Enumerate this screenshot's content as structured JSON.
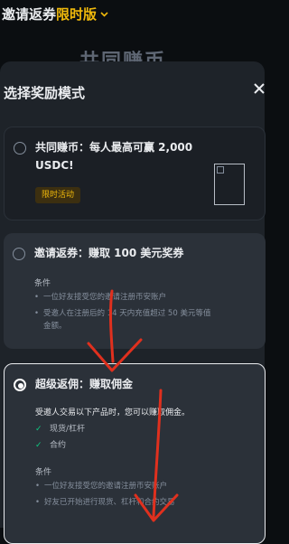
{
  "background": {
    "header_title": "邀请返券",
    "header_title_accent": "限时版",
    "header_icon": "chevron-down-icon",
    "headline": "共同赚币"
  },
  "sheet": {
    "title": "选择奖励模式",
    "close_icon": "close-icon"
  },
  "options": [
    {
      "title_line1": "共同赚币：每人最高可赢 2,000",
      "title_line2": "USDC!",
      "tag": "限时活动",
      "selected": false
    },
    {
      "title": "邀请返券：赚取 100 美元奖券",
      "conditions_label": "条件",
      "conditions": [
        "一位好友接受您的邀请注册币安账户",
        "受邀人在注册后的 14 天内充值超过 50 美元等值",
        "金额。"
      ],
      "selected": false
    },
    {
      "title": "超级返佣：赚取佣金",
      "description": "受邀人交易以下产品时，您可以赚取佣金。",
      "products": [
        "现货/杠杆",
        "合约"
      ],
      "conditions_label": "条件",
      "conditions": [
        "一位好友接受您的邀请注册币安账户",
        "好友已开始进行现货、杠杆和合约交易"
      ],
      "selected": true
    }
  ],
  "colors": {
    "accent": "#f0b90b",
    "check": "#0ecb81",
    "annotation": "#e0301e"
  }
}
